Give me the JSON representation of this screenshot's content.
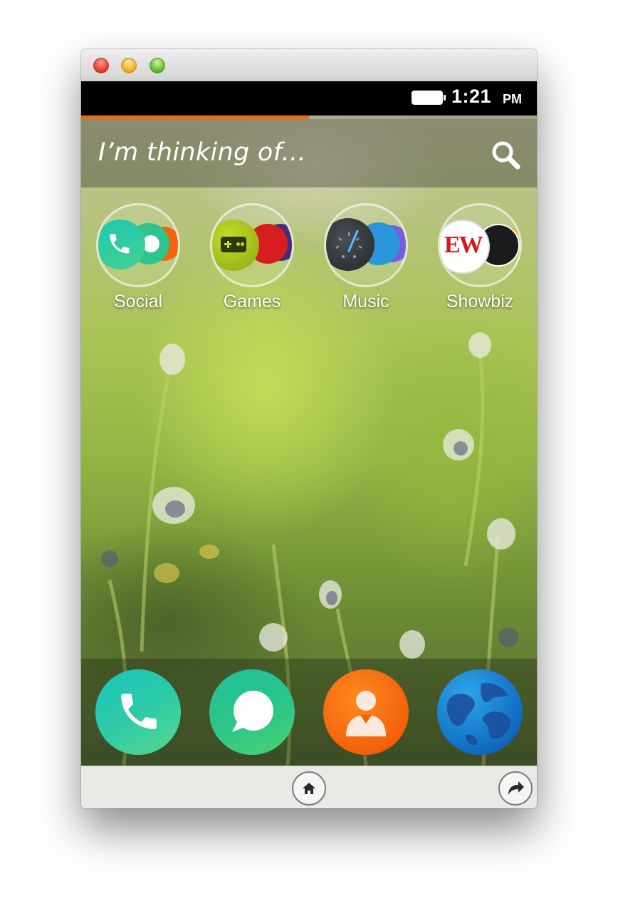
{
  "statusbar": {
    "time": "1:21",
    "ampm": "PM"
  },
  "load_progress": 0.5,
  "search": {
    "placeholder": "I’m thinking of..."
  },
  "collections": [
    {
      "label": "Social",
      "icon": "social-collection-icon"
    },
    {
      "label": "Games",
      "icon": "games-collection-icon"
    },
    {
      "label": "Music",
      "icon": "music-collection-icon"
    },
    {
      "label": "Showbiz",
      "icon": "showbiz-collection-icon"
    }
  ],
  "dock": [
    {
      "name": "phone",
      "icon": "phone-icon",
      "color": "#1fc6b5"
    },
    {
      "name": "messages",
      "icon": "message-icon",
      "color": "#27c489"
    },
    {
      "name": "contacts",
      "icon": "contact-icon",
      "color": "#f7630c"
    },
    {
      "name": "browser",
      "icon": "globe-icon",
      "color": "#1a70c9"
    }
  ],
  "showbiz_logo_text": "EW",
  "colors": {
    "accent": "#ef6c0a",
    "statusbar": "#000000",
    "navbar": "#ebe9e5"
  }
}
